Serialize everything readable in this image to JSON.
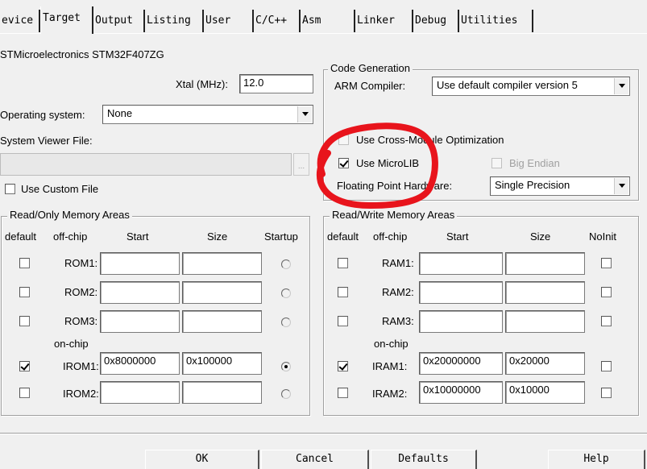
{
  "tabs": [
    "evice",
    "Target",
    "Output",
    "Listing",
    "User",
    "C/C++",
    "Asm",
    "Linker",
    "Debug",
    "Utilities"
  ],
  "active_tab": "Target",
  "device": {
    "name": "STMicroelectronics STM32F407ZG"
  },
  "xtal": {
    "label": "Xtal (MHz):",
    "value": "12.0"
  },
  "os": {
    "label": "Operating system:",
    "value": "None"
  },
  "svd": {
    "label": "System Viewer File:",
    "value": "",
    "browse": "...",
    "custom_label": "Use Custom File"
  },
  "codegen": {
    "title": "Code Generation",
    "compiler_label": "ARM Compiler:",
    "compiler_value": "Use default compiler version 5",
    "cross_module_label": "Use Cross-Module Optimization",
    "microlib_label": "Use MicroLIB",
    "big_endian_label": "Big Endian",
    "fpu_label": "Floating Point Hardware:",
    "fpu_value": "Single Precision"
  },
  "rom": {
    "title": "Read/Only Memory Areas",
    "headers": [
      "default",
      "off-chip",
      "Start",
      "Size",
      "Startup"
    ],
    "onchip_label": "on-chip",
    "rows": [
      {
        "name": "ROM1:",
        "start": "",
        "size": ""
      },
      {
        "name": "ROM2:",
        "start": "",
        "size": ""
      },
      {
        "name": "ROM3:",
        "start": "",
        "size": ""
      },
      {
        "name": "IROM1:",
        "start": "0x8000000",
        "size": "0x100000"
      },
      {
        "name": "IROM2:",
        "start": "",
        "size": ""
      }
    ]
  },
  "ram": {
    "title": "Read/Write Memory Areas",
    "headers": [
      "default",
      "off-chip",
      "Start",
      "Size",
      "NoInit"
    ],
    "onchip_label": "on-chip",
    "rows": [
      {
        "name": "RAM1:",
        "start": "",
        "size": ""
      },
      {
        "name": "RAM2:",
        "start": "",
        "size": ""
      },
      {
        "name": "RAM3:",
        "start": "",
        "size": ""
      },
      {
        "name": "IRAM1:",
        "start": "0x20000000",
        "size": "0x20000"
      },
      {
        "name": "IRAM2:",
        "start": "0x10000000",
        "size": "0x10000"
      }
    ]
  },
  "buttons": {
    "ok": "OK",
    "cancel": "Cancel",
    "defaults": "Defaults",
    "help": "Help"
  },
  "colors": {
    "annotation": "#e8141c",
    "background": "#f0f0f0"
  }
}
